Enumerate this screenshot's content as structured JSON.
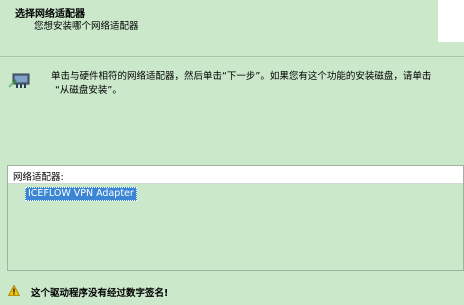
{
  "header": {
    "title": "选择网络适配器",
    "subtitle": "您想安装哪个网络适配器"
  },
  "instructions": {
    "icon": "network-adapter-icon",
    "line1": "单击与硬件相符的网络适配器，然后单击“下一步”。如果您有这个功能的安装磁盘，请单击",
    "line2": "“从磁盘安装”。"
  },
  "adapter_list": {
    "header": "网络适配器:",
    "items": [
      "ICEFLOW VPN Adapter"
    ],
    "selected_index": 0
  },
  "warning": {
    "icon": "warning-icon",
    "text": "这个驱动程序没有经过数字签名!"
  },
  "colors": {
    "background": "#cbe8cb",
    "selection": "#3b86d4"
  }
}
